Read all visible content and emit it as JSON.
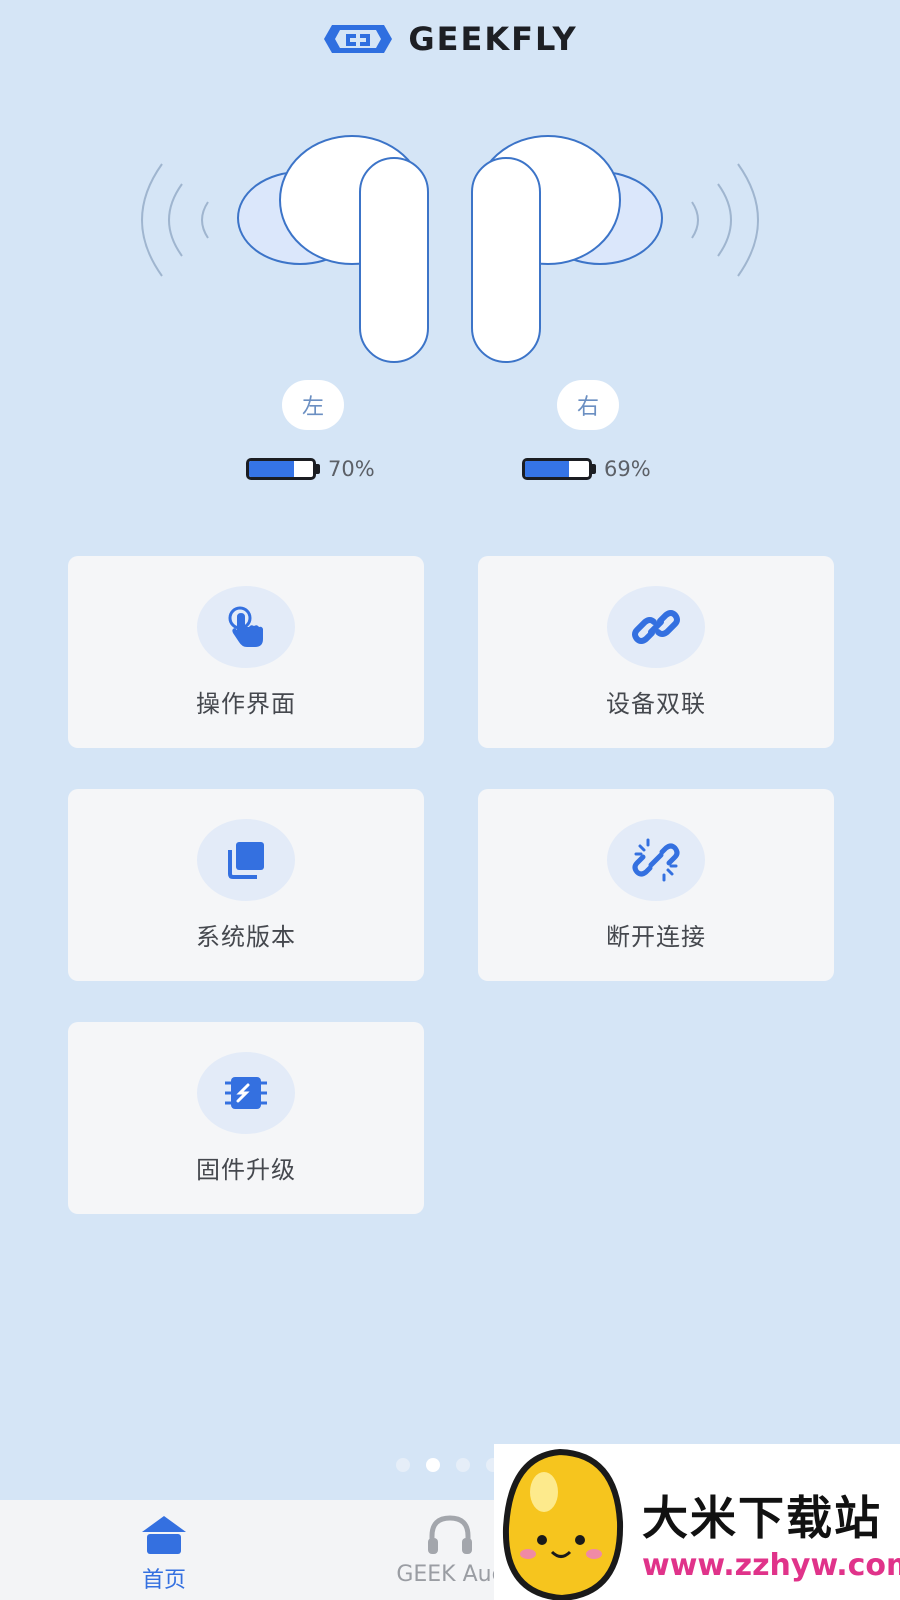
{
  "header": {
    "brand": "GEEKFLY"
  },
  "earbuds": {
    "left": {
      "label": "左",
      "battery_text": "70%",
      "battery_level": 0.7
    },
    "right": {
      "label": "右",
      "battery_text": "69%",
      "battery_level": 0.69
    }
  },
  "menu": {
    "items": [
      {
        "label": "操作界面",
        "icon": "touch-hand-icon"
      },
      {
        "label": "设备双联",
        "icon": "link-icon"
      },
      {
        "label": "系统版本",
        "icon": "layers-icon"
      },
      {
        "label": "断开连接",
        "icon": "unlink-icon"
      },
      {
        "label": "固件升级",
        "icon": "chip-icon"
      }
    ]
  },
  "pager": {
    "active_index": 1,
    "count": 4
  },
  "tabbar": {
    "tabs": [
      {
        "label": "首页",
        "icon": "home-icon",
        "active": true
      },
      {
        "label": "GEEK Auc",
        "icon": "headphones-icon",
        "active": false
      }
    ]
  },
  "watermark": {
    "title": "大米下载站",
    "url": "www.zzhyw.com"
  },
  "colors": {
    "accent": "#3470e0",
    "background": "#d5e5f6",
    "card": "#f5f6f8"
  }
}
